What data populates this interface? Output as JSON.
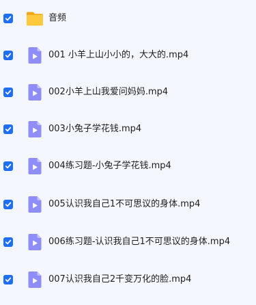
{
  "items": [
    {
      "name": "音频",
      "type": "folder",
      "selected": true,
      "icon": "folder-icon"
    },
    {
      "name": "001 小羊上山小小的，大大的.mp4",
      "type": "video",
      "selected": true,
      "icon": "video-file-icon"
    },
    {
      "name": "002小羊上山我爱问妈妈.mp4",
      "type": "video",
      "selected": true,
      "icon": "video-file-icon"
    },
    {
      "name": "003小兔子学花钱.mp4",
      "type": "video",
      "selected": true,
      "icon": "video-file-icon"
    },
    {
      "name": "004练习题-小兔子学花钱.mp4",
      "type": "video",
      "selected": true,
      "icon": "video-file-icon"
    },
    {
      "name": "005认识我自己1不可思议的身体.mp4",
      "type": "video",
      "selected": true,
      "icon": "video-file-icon"
    },
    {
      "name": "006练习题-认识我自己1不可思议的身体.mp4",
      "type": "video",
      "selected": true,
      "icon": "video-file-icon"
    },
    {
      "name": "007认识我自己2千变万化的脸.mp4",
      "type": "video",
      "selected": true,
      "icon": "video-file-icon"
    }
  ],
  "colors": {
    "checkbox": "#1e6ff3",
    "folder": "#ffc93d",
    "video_icon": "#8f8df7",
    "background": "#f4f8fe"
  }
}
